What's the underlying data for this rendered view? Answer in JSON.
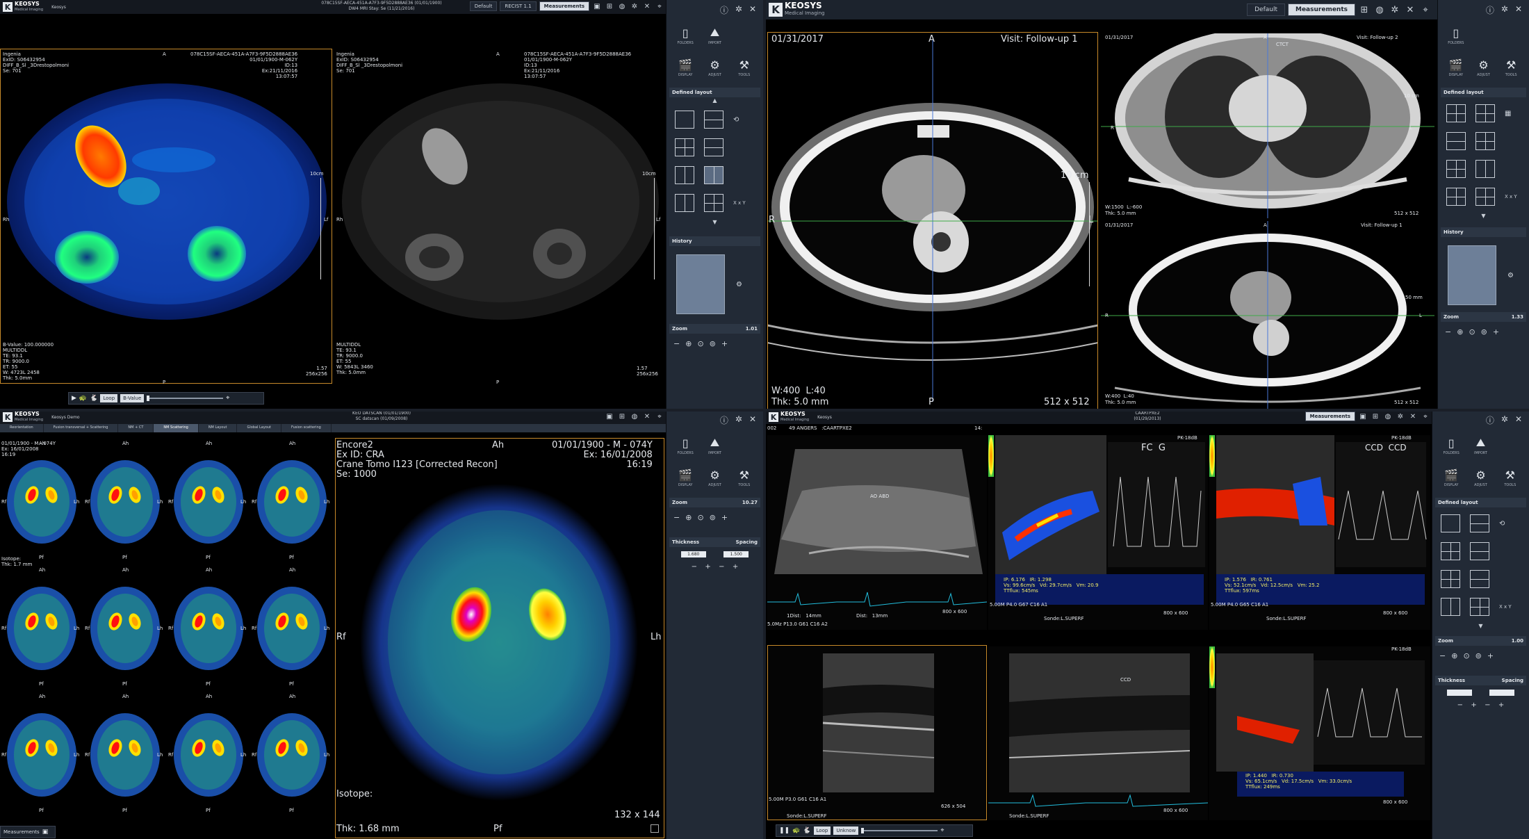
{
  "brand": {
    "name": "KEOSYS",
    "subtitle": "Medical Imaging"
  },
  "q1": {
    "user": "Keosys",
    "title_line1": "078C15SF-AECA-451A-A7F3-9F5D2888AE36 (01/01/1900)",
    "title_line2": "DW4 MRI Stay: Se (11/21/2016)",
    "buttons": [
      "Default",
      "RECIST 1.1",
      "Measurements"
    ],
    "left": {
      "name": "Ingenia",
      "exid": "ExID: S06432954",
      "series": "DIFF_B_Sl _3Drestopolmoni",
      "se": "Se: 701",
      "orient_top": "A",
      "orient_left": "Rh",
      "orient_right": "Lf",
      "orient_bottom": "P",
      "scale": "10cm",
      "bottom_info": "B-Value: 100.000000\nMULTIDDL\nTE: 93.1\nTR: 9000.0\nET: 55\nW: 4723L 2458\nThk: 5.0mm",
      "right_top": "078C15SF-AECA-451A-A7F3-9F5D2888AE36\n01/01/1900-M-062Y\nID:13\nEx:21/11/2016\n13:07:57",
      "bottom_right": "1.57\n256x256"
    },
    "right": {
      "name": "Ingenia",
      "exid": "ExID: S06432954",
      "series": "DIFF_B_Sl _3Drestopolmoni",
      "se": "Se: 701",
      "orient_top": "A",
      "orient_left": "Rh",
      "orient_right": "Lf",
      "orient_bottom": "P",
      "scale": "10cm",
      "bottom_info": "MULTIDDL\nTE: 93.1\nTR: 9000.0\nET: 55\nW: 5843L 3460\nThk: 5.0mm",
      "right_top": "078C15SF-AECA-451A-A7F3-9F5D2888AE36\n01/01/1900-M-062Y\nID:13\nEx:21/11/2016\n13:07:57",
      "bottom_right": "1.57\n256x256"
    },
    "toolbar": {
      "mode": "Loop",
      "value": "B-Value"
    },
    "side": {
      "tools": [
        "FOLDERS",
        "IMPORT",
        "DISPLAY",
        "ADJUST",
        "TOOLS"
      ],
      "defined_layout": "Defined layout",
      "history": "History",
      "zoom_label": "Zoom",
      "zoom_value": "1.01",
      "xy_label": "X x Y"
    }
  },
  "q2": {
    "buttons": [
      "Default",
      "Measurements"
    ],
    "main": {
      "date": "01/31/2017",
      "visit": "Visit: Follow-up 1",
      "orient_top": "A",
      "orient_left": "R",
      "orient_right": "L",
      "orient_bottom": "P",
      "scale": "10 cm",
      "wl": "W:400  L:40",
      "thk": "Thk: 5.0 mm",
      "matrix": "512 x 512"
    },
    "top_right": {
      "date": "01/31/2017",
      "visit": "Visit: Follow-up 2",
      "tag": "CTCT",
      "orient_top": "A",
      "orient_left": "R",
      "orient_right": "L",
      "scale": "10 cm",
      "wl": "W:1500  L:-600",
      "thk": "Thk: 5.0 mm",
      "matrix": "512 x 512"
    },
    "bottom_right": {
      "date": "01/31/2017",
      "visit": "Visit: Follow-up 1",
      "orient_top": "A",
      "orient_left": "R",
      "orient_right": "L",
      "scale": "50 mm",
      "wl": "W:400  L:40",
      "thk": "Thk: 5.0 mm",
      "matrix": "512 x 512"
    },
    "side": {
      "tools": [
        "FOLDERS",
        "DISPLAY",
        "ADJUST",
        "TOOLS"
      ],
      "defined_layout": "Defined layout",
      "history": "History",
      "zoom_label": "Zoom",
      "zoom_value": "1.33",
      "xy_label": "X x Y"
    }
  },
  "q3": {
    "user": "Keosys Demo",
    "title_line1": "KEO DATSCAN (01/01/1900)",
    "title_line2": "SC datscan (01/09/2008)",
    "tabs": [
      "Reorientation",
      "Fusion transversal + Scattering",
      "NM + CT",
      "NM Scattering",
      "NM Layout",
      "Global Layout",
      "Fusion scattering"
    ],
    "active_tab": 3,
    "grid_header": "01/01/1900 - M - 074Y\nEx: 16/01/2008\n16:19",
    "isotope_small": "Isotope:\nThk: 1.7 mm",
    "grid_labels": {
      "top": "Ah",
      "bottom": "Pf",
      "left": "Rf",
      "right": "Lh"
    },
    "large": {
      "name": "Encore2",
      "exid": "Ex ID: CRA",
      "series": "Crane Tomo I123 [Corrected Recon]",
      "se": "Se: 1000",
      "right_top": "01/01/1900 - M - 074Y\nEx: 16/01/2008\n16:19",
      "orient_top": "Ah",
      "orient_left": "Rf",
      "orient_right": "Lh",
      "orient_bottom": "Pf",
      "isotope": "Isotope:",
      "thk": "Thk: 1.68 mm",
      "matrix": "132 x 144"
    },
    "bottom_tab": "Measurements",
    "side": {
      "tools": [
        "FOLDERS",
        "IMPORT",
        "DISPLAY",
        "ADJUST",
        "TOOLS"
      ],
      "zoom_label": "Zoom",
      "zoom_value": "10.27",
      "thickness_label": "Thickness",
      "spacing_label": "Spacing",
      "thickness_value": "1.680",
      "spacing_value": "1.500"
    }
  },
  "q4": {
    "user": "Keosys",
    "title_line1": "CAARTPXE2",
    "title_line2": "(01/29/2013)",
    "header_left": "002        49 ANGERS   :CAARTPXE2",
    "header_right": "14:",
    "buttons": [
      "Measurements"
    ],
    "us1": {
      "text": "AO ABD",
      "dist1": "1Dist:   14mm",
      "dist2": "Dist:   13mm",
      "matrix": "800 x 600",
      "footer": "5.0Mz P13.0 G61 C16 A2"
    },
    "us2": {
      "tag": "FC  G",
      "pk": "PK-18dB",
      "vals": "IP: 6.176   IR: 1.298\nVs: 99.6cm/s   Vd: 29.7cm/s   Vm: 20.9\nTTflux: 545ms",
      "matrix": "800 x 600",
      "footer": "5.00M P4.0 G67 C16 A1",
      "sonde": "Sonde:L.SUPERF"
    },
    "us3": {
      "tag": "CCD  CCD",
      "pk": "PK-18dB",
      "vals": "IP: 1.576   IR: 0.761\nVs: 52.1cm/s   Vd: 12.5cm/s   Vm: 25.2\nTTflux: 597ms",
      "matrix": "800 x 600",
      "footer": "5.00M P4.0 G65 C16 A1",
      "sonde": "Sonde:L.SUPERF"
    },
    "us4": {
      "matrix": "626 x 504",
      "sonde": "Sonde:L.SUPERF",
      "footer": "5.00M P3.0 G61 C16 A1"
    },
    "us5": {
      "matrix": "800 x 600",
      "sonde": "Sonde:L.SUPERF",
      "label": "CCD"
    },
    "us6": {
      "vals": "IP: 1.440   IR: 0.730\nVs: 65.1cm/s   Vd: 17.5cm/s   Vm: 33.0cm/s\nTTflux: 249ms",
      "matrix": "800 x 600",
      "pk": "PK-18dB"
    },
    "toolbar": {
      "mode": "Loop",
      "value": "Unknow"
    },
    "side": {
      "tools": [
        "FOLDERS",
        "IMPORT",
        "DISPLAY",
        "ADJUST",
        "TOOLS"
      ],
      "defined_layout": "Defined layout",
      "zoom_label": "Zoom",
      "zoom_value": "1.00",
      "thickness_label": "Thickness",
      "spacing_label": "Spacing",
      "xy_label": "X x Y"
    }
  }
}
